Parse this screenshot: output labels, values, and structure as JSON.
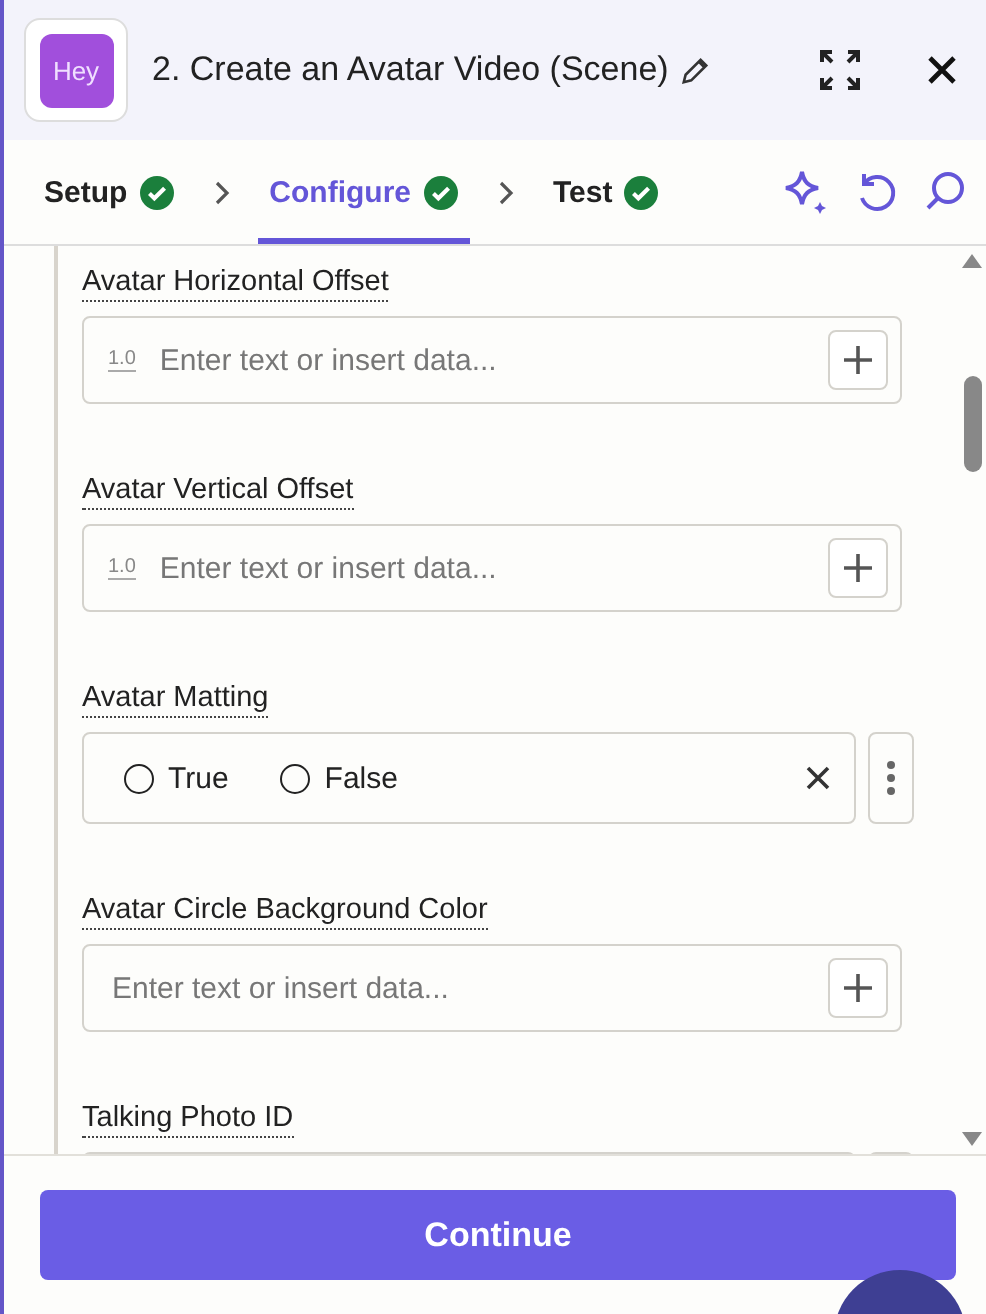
{
  "header": {
    "logo": "Hey",
    "title": "2. Create an Avatar Video (Scene)"
  },
  "steps": [
    {
      "label": "Setup",
      "selected": false,
      "complete": true
    },
    {
      "label": "Configure",
      "selected": true,
      "complete": true
    },
    {
      "label": "Test",
      "selected": false,
      "complete": true
    }
  ],
  "fields": [
    {
      "kind": "text",
      "label": "Avatar Horizontal Offset",
      "prefix": "1.0",
      "placeholder": "Enter text or insert data..."
    },
    {
      "kind": "text",
      "label": "Avatar Vertical Offset",
      "prefix": "1.0",
      "placeholder": "Enter text or insert data..."
    },
    {
      "kind": "radio",
      "label": "Avatar Matting",
      "options": [
        {
          "label": "True",
          "selected": false
        },
        {
          "label": "False",
          "selected": false
        }
      ]
    },
    {
      "kind": "text",
      "label": "Avatar Circle Background Color",
      "placeholder": "Enter text or insert data..."
    },
    {
      "kind": "select",
      "label": "Talking Photo ID"
    }
  ],
  "footer": {
    "button": "Continue"
  }
}
